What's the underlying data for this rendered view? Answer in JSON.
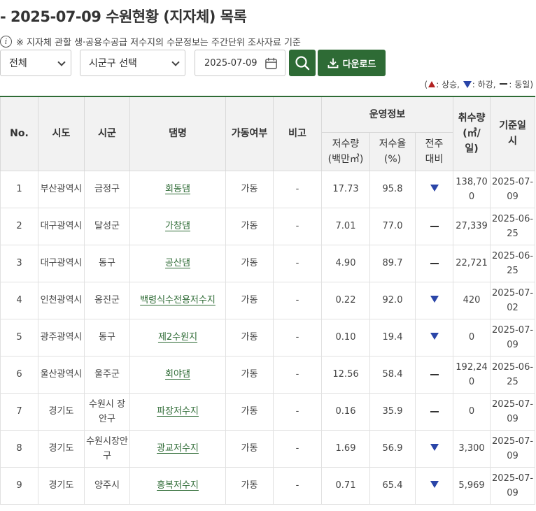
{
  "page": {
    "title": "- 2025-07-09 수원현황 (지자체) 목록",
    "notice": "※ 지자체 관할 생·공용수공급 저수지의 수문정보는 주간단위 조사자료 기준",
    "info_icon": "info-icon"
  },
  "filters": {
    "region_selected": "전체",
    "city_selected": "시군구 선택",
    "date_value": "2025-07-09",
    "search_icon": "search-icon",
    "download_label": "다운로드",
    "download_icon": "download-icon"
  },
  "legend": {
    "open": "(",
    "up_label": ": 상승, ",
    "down_label": ": 하강, ",
    "same_label": ": 동일)",
    "up_color": "#b22222",
    "down_color": "#2a45a8"
  },
  "table": {
    "headers": {
      "no": "No.",
      "sido": "시도",
      "sigun": "시군",
      "dam": "댐명",
      "status": "가동여부",
      "note": "비고",
      "operation": "운영정보",
      "storage": "저수량\n(백만㎥)",
      "rate": "저수율\n(%)",
      "prev": "전주\n대비",
      "intake": "취수량\n(㎥/\n일)",
      "date": "기준일\n시"
    },
    "rows": [
      {
        "no": "1",
        "sido": "부산광역시",
        "sigun": "금정구",
        "dam": "회동댐",
        "status": "가동",
        "note": "-",
        "storage": "17.73",
        "rate": "95.8",
        "trend": "down",
        "intake": "138,700",
        "date": "2025-07-09"
      },
      {
        "no": "2",
        "sido": "대구광역시",
        "sigun": "달성군",
        "dam": "가창댐",
        "status": "가동",
        "note": "-",
        "storage": "7.01",
        "rate": "77.0",
        "trend": "same",
        "intake": "27,339",
        "date": "2025-06-25"
      },
      {
        "no": "3",
        "sido": "대구광역시",
        "sigun": "동구",
        "dam": "공산댐",
        "status": "가동",
        "note": "-",
        "storage": "4.90",
        "rate": "89.7",
        "trend": "same",
        "intake": "22,721",
        "date": "2025-06-25"
      },
      {
        "no": "4",
        "sido": "인천광역시",
        "sigun": "옹진군",
        "dam": "백령식수전용저수지",
        "status": "가동",
        "note": "-",
        "storage": "0.22",
        "rate": "92.0",
        "trend": "down",
        "intake": "420",
        "date": "2025-07-02"
      },
      {
        "no": "5",
        "sido": "광주광역시",
        "sigun": "동구",
        "dam": "제2수원지",
        "status": "가동",
        "note": "-",
        "storage": "0.10",
        "rate": "19.4",
        "trend": "down",
        "intake": "0",
        "date": "2025-07-09"
      },
      {
        "no": "6",
        "sido": "울산광역시",
        "sigun": "울주군",
        "dam": "회야댐",
        "status": "가동",
        "note": "-",
        "storage": "12.56",
        "rate": "58.4",
        "trend": "same",
        "intake": "192,240",
        "date": "2025-06-25"
      },
      {
        "no": "7",
        "sido": "경기도",
        "sigun": "수원시 장안구",
        "dam": "파장저수지",
        "status": "가동",
        "note": "-",
        "storage": "0.16",
        "rate": "35.9",
        "trend": "same",
        "intake": "0",
        "date": "2025-07-09"
      },
      {
        "no": "8",
        "sido": "경기도",
        "sigun": "수원시장안구",
        "dam": "광교저수지",
        "status": "가동",
        "note": "-",
        "storage": "1.69",
        "rate": "56.9",
        "trend": "down",
        "intake": "3,300",
        "date": "2025-07-09"
      },
      {
        "no": "9",
        "sido": "경기도",
        "sigun": "양주시",
        "dam": "홍복저수지",
        "status": "가동",
        "note": "-",
        "storage": "0.71",
        "rate": "65.4",
        "trend": "down",
        "intake": "5,969",
        "date": "2025-07-09"
      }
    ]
  },
  "colors": {
    "brand_green": "#2e6b35",
    "header_bg": "#f2f2f2"
  }
}
